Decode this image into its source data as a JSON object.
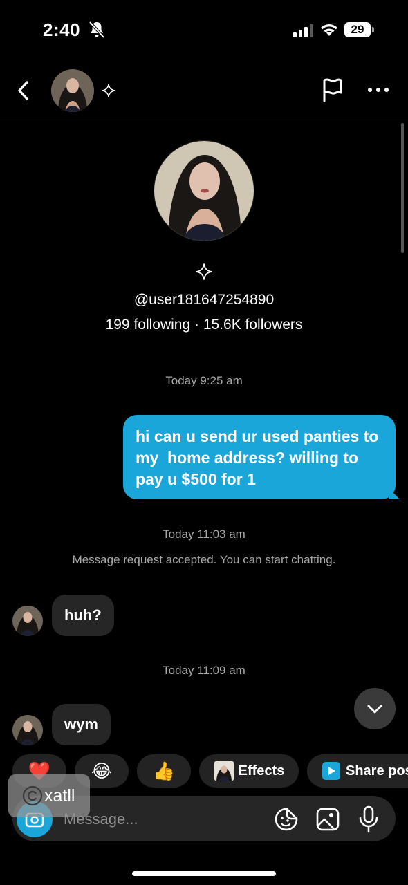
{
  "status_bar": {
    "time": "2:40",
    "battery": "29",
    "icons": [
      "bell-slash-icon",
      "signal-icon",
      "wifi-icon",
      "battery-icon"
    ]
  },
  "header": {
    "icons": [
      "chevron-left-icon",
      "sparkle-icon",
      "flag-icon",
      "more-horizontal-icon"
    ]
  },
  "profile": {
    "username": "@user181647254890",
    "stats": "199 following · 15.6K followers"
  },
  "messages": [
    {
      "type": "timestamp",
      "text": "Today 9:25 am"
    },
    {
      "type": "outgoing",
      "lines": [
        "hi can u send ur used panties to",
        "my  home address? willing to",
        "pay u $500 for 1"
      ]
    },
    {
      "type": "timestamp",
      "text": "Today 11:03 am"
    },
    {
      "type": "system",
      "text": "Message request accepted. You can start chatting."
    },
    {
      "type": "incoming",
      "text": "huh?"
    },
    {
      "type": "timestamp",
      "text": "Today 11:09 am"
    },
    {
      "type": "incoming",
      "text": "wym"
    }
  ],
  "quick_actions": {
    "reactions": [
      "❤️",
      "😂",
      "👍"
    ],
    "effects_label": "Effects",
    "share_label": "Share pos"
  },
  "composer": {
    "placeholder": "Message..."
  },
  "watermark": {
    "text": "xatll"
  },
  "colors": {
    "background": "#000000",
    "accent": "#1aa6d9",
    "bubble_incoming": "#262626",
    "secondary_text": "#a8a8a8"
  }
}
